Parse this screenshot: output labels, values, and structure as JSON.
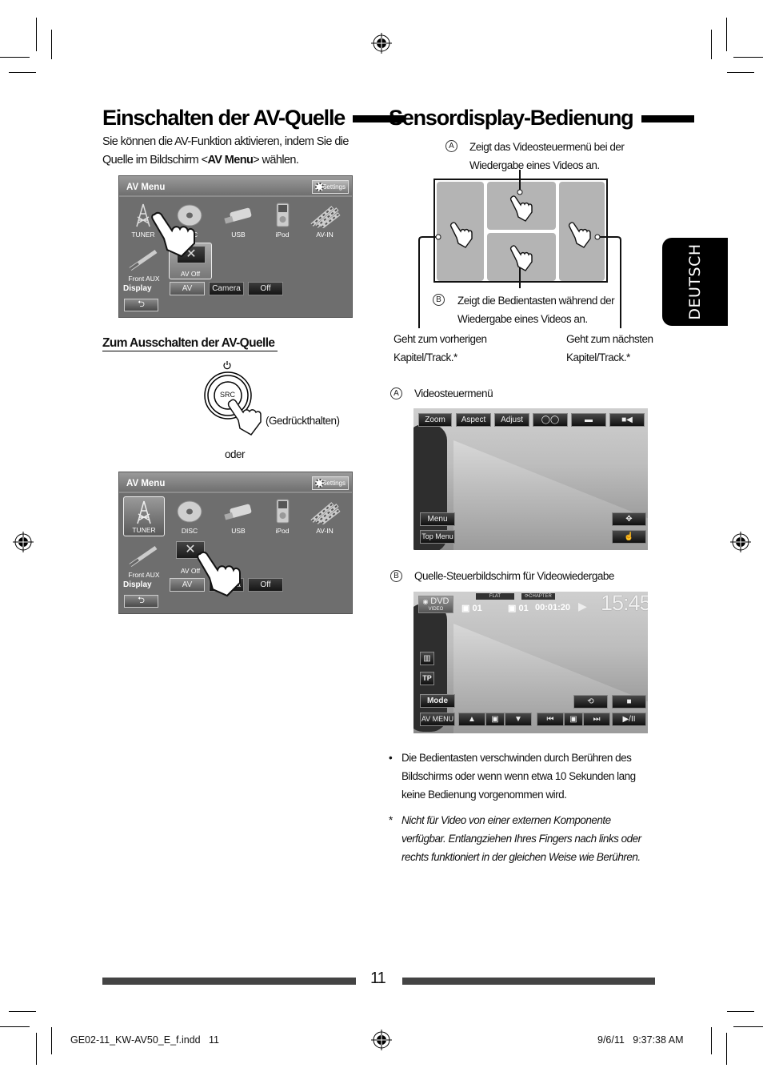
{
  "left": {
    "heading": "Einschalten der AV-Quelle",
    "intro_line1": "Sie können die AV-Funktion aktivieren, indem Sie die",
    "intro_line2_pre": "Quelle im Bildschirm <",
    "intro_line2_bold": "AV Menu",
    "intro_line2_post": "> wählen.",
    "av_menu_screen": {
      "title": "AV Menu",
      "settings_label": "Settings",
      "sources": [
        "TUNER",
        "DISC",
        "USB",
        "iPod",
        "AV-IN"
      ],
      "front_aux_label": "Front AUX",
      "av_off_label": "AV Off",
      "display_label": "Display",
      "display_buttons": [
        "AV",
        "Camera",
        "Off"
      ],
      "back_icon": "back-arrow-icon"
    },
    "subheading": "Zum Ausschalten der AV-Quelle",
    "src_button_label": "SRC",
    "power_icon": "power-icon",
    "hold_label": "(Gedrückthalten)",
    "or_label": "oder"
  },
  "right": {
    "heading": "Sensordisplay-Bedienung",
    "callout_a_letter": "A",
    "callout_a_line1": "Zeigt das Videosteuermenü bei der",
    "callout_a_line2": "Wiedergabe eines Videos an.",
    "callout_b_letter": "B",
    "callout_b_line1": "Zeigt die Bedientasten während der",
    "callout_b_line2": "Wiedergabe eines Videos an.",
    "prev_line1": "Geht zum vorherigen",
    "prev_line2": "Kapitel/Track.*",
    "next_line1": "Geht zum nächsten",
    "next_line2": "Kapitel/Track.*",
    "section_a_letter": "A",
    "section_a_title": "Videosteuermenü",
    "video_menu_buttons": [
      "Zoom",
      "Aspect",
      "Adjust",
      "audio-icon",
      "subtitle-icon",
      "angle-icon"
    ],
    "video_menu_bottom_left": [
      "Menu",
      "Top Menu"
    ],
    "section_b_letter": "B",
    "section_b_title": "Quelle-Steuerbildschirm für Videowiedergabe",
    "source_screen": {
      "source_label": "DVD",
      "source_sub": "VIDEO",
      "flat_label": "FLAT",
      "chapter_label": "CHAPTER",
      "title_num": "01",
      "chapter_num": "01",
      "time": "00:01:20",
      "clock": "15:45",
      "eq_icon": "equalizer-icon",
      "tp_label": "TP",
      "mode_label": "Mode",
      "av_menu_label": "AV MENU"
    },
    "bullet": "Die Bedientasten verschwinden durch Berühren des Bildschirms oder wenn wenn etwa 10 Sekunden lang keine Bedienung vorgenommen wird.",
    "bullet_lines": [
      "Die Bedientasten verschwinden durch Berühren des",
      "Bildschirms oder wenn wenn etwa 10 Sekunden lang",
      "keine Bedienung vorgenommen wird."
    ],
    "footnote_marker": "*",
    "footnote_lines": [
      "Nicht für Video von einer externen Komponente",
      "verfügbar. Entlangziehen Ihres Fingers nach links oder",
      "rechts funktioniert in der gleichen Weise wie Berühren."
    ]
  },
  "side_tab": "DEUTSCH",
  "page_number": "11",
  "slug_left": "GE02-11_KW-AV50_E_f.indd   11",
  "slug_right": "9/6/11   9:37:38 AM"
}
